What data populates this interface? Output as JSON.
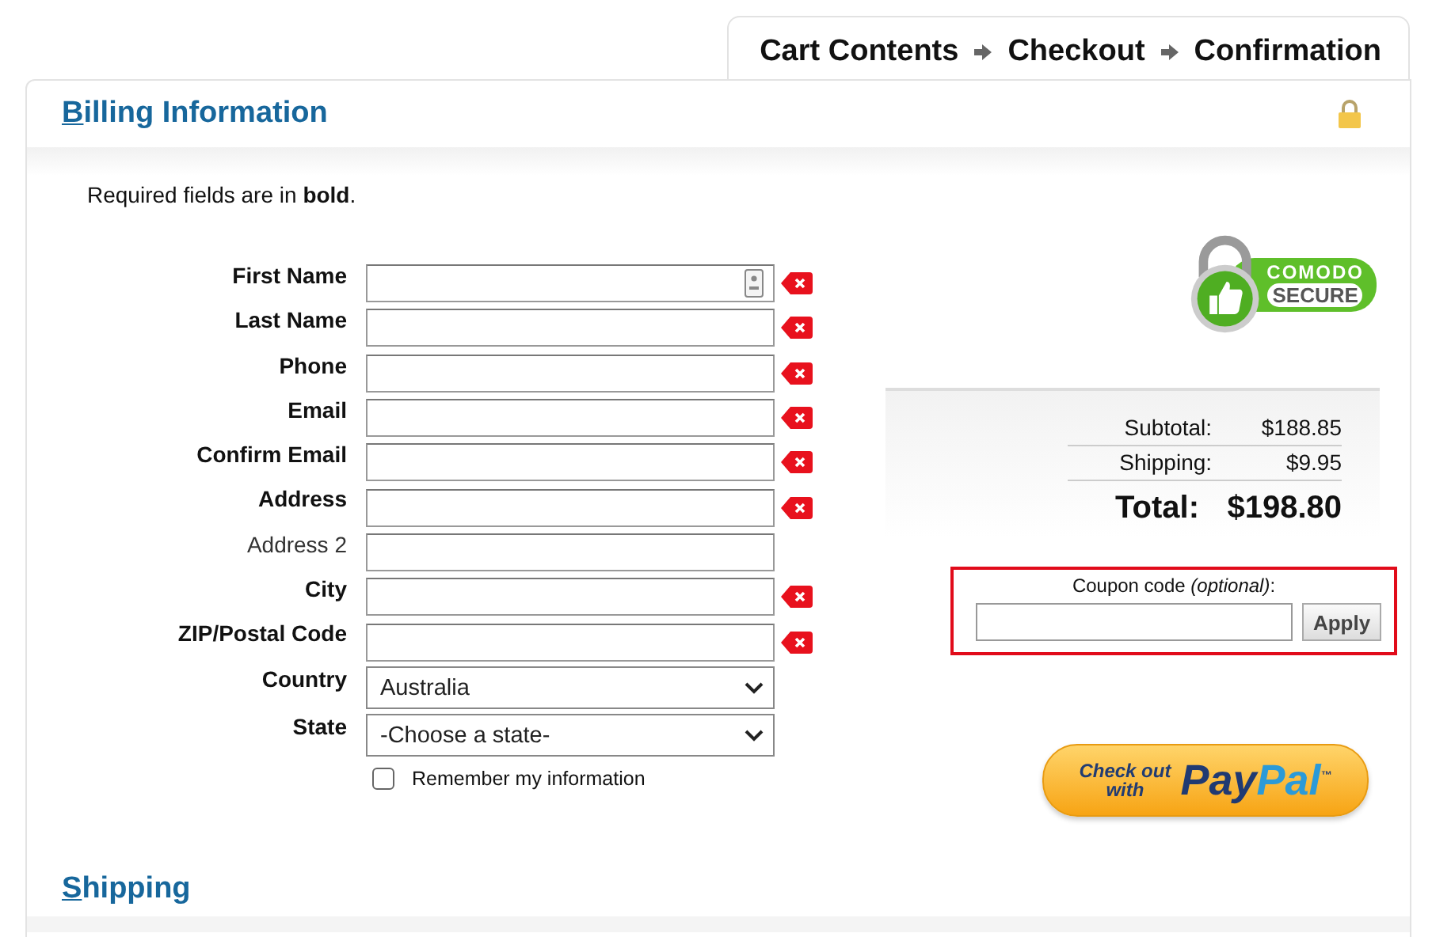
{
  "breadcrumb": [
    "Cart Contents",
    "Checkout",
    "Confirmation"
  ],
  "billing": {
    "title": "Billing Information",
    "note": "Required fields are in **bold**.",
    "fields": [
      {
        "kind": "text",
        "label": "First Name",
        "required": true,
        "autofill": true
      },
      {
        "kind": "text",
        "label": "Last Name",
        "required": true,
        "autofill": false
      },
      {
        "kind": "text",
        "label": "Phone",
        "required": true,
        "autofill": false
      },
      {
        "kind": "text",
        "label": "Email",
        "required": true,
        "autofill": false
      },
      {
        "kind": "text",
        "label": "Confirm Email",
        "required": true,
        "autofill": false
      },
      {
        "kind": "text",
        "label": "Address",
        "required": true,
        "autofill": false
      },
      {
        "kind": "text",
        "label": "Address 2",
        "required": false,
        "autofill": false
      },
      {
        "kind": "text",
        "label": "City",
        "required": true,
        "autofill": false
      },
      {
        "kind": "text",
        "label": "ZIP/Postal Code",
        "required": true,
        "autofill": false
      },
      {
        "kind": "select",
        "label": "Country",
        "required": true,
        "value": "Australia"
      },
      {
        "kind": "select",
        "label": "State",
        "required": true,
        "value": "-Choose a state-"
      }
    ],
    "remember": {
      "label": "Remember my information",
      "checked": false
    }
  },
  "seal": {
    "line1": "COMODO",
    "line2": "SECURE"
  },
  "totals": [
    {
      "kind": "sub",
      "label": "Subtotal:",
      "value": "$188.85"
    },
    {
      "kind": "sub",
      "label": "Shipping:",
      "value": "$9.95"
    },
    {
      "kind": "total",
      "label": "Total:",
      "value": "$198.80"
    }
  ],
  "coupon": {
    "label": "Coupon code *(optional)*:",
    "button": "Apply"
  },
  "paypal": {
    "line1": "Check out",
    "line2": "with",
    "brand_1": "Pay",
    "brand_2": "Pal",
    "tm": "™"
  },
  "shipping": {
    "title": "Shipping"
  }
}
